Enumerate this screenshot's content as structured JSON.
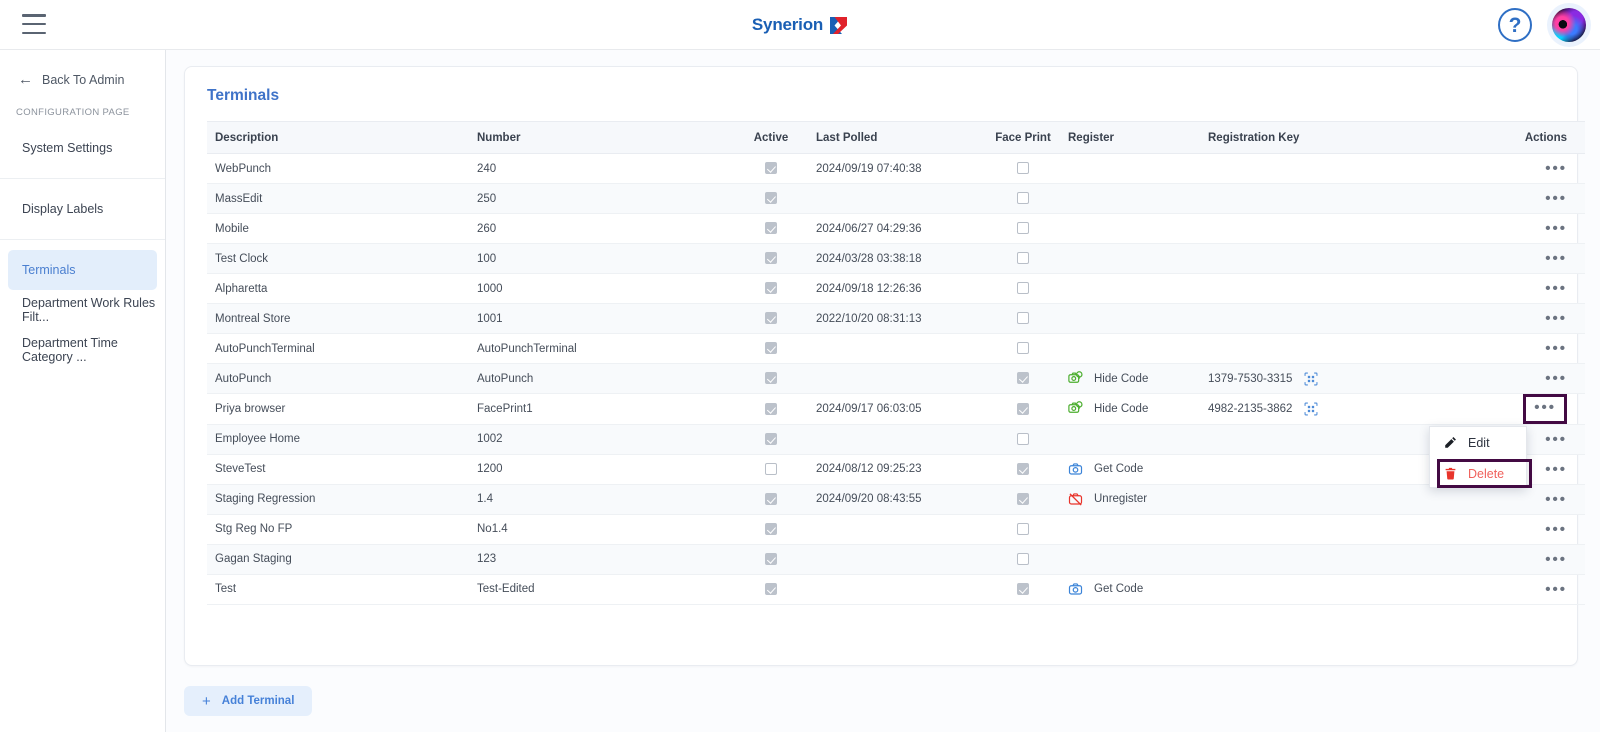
{
  "app": {
    "brand_name": "Synerion",
    "brand_color": "#1a5fb4",
    "accent_color": "#3f73c8",
    "highlight_color": "#430a43",
    "delete_color": "#f0615c"
  },
  "topbar": {
    "menu_icon": "hamburger-icon",
    "help_label": "?",
    "avatar_label": ""
  },
  "sidebar": {
    "back_label": "Back To Admin",
    "section_label": "CONFIGURATION PAGE",
    "items": [
      {
        "label": "System Settings",
        "active": false
      },
      {
        "label": "Display Labels",
        "active": false
      },
      {
        "label": "Terminals",
        "active": true
      },
      {
        "label": "Department Work Rules Filt...",
        "active": false
      },
      {
        "label": "Department Time Category ...",
        "active": false
      }
    ]
  },
  "main": {
    "title": "Terminals",
    "add_button_label": "Add Terminal",
    "add_button_plus": "+",
    "columns": [
      "Description",
      "Number",
      "Active",
      "Last Polled",
      "Face Print",
      "Register",
      "Registration Key",
      "Actions"
    ],
    "rows": [
      {
        "description": "WebPunch",
        "number": "240",
        "active": true,
        "last_polled": "2024/09/19 07:40:38",
        "face_print": false,
        "register": "",
        "register_icon": "",
        "registration_key": "",
        "actions": "•••"
      },
      {
        "description": "MassEdit",
        "number": "250",
        "active": true,
        "last_polled": "",
        "face_print": false,
        "register": "",
        "register_icon": "",
        "registration_key": "",
        "actions": "•••"
      },
      {
        "description": "Mobile",
        "number": "260",
        "active": true,
        "last_polled": "2024/06/27 04:29:36",
        "face_print": false,
        "register": "",
        "register_icon": "",
        "registration_key": "",
        "actions": "•••"
      },
      {
        "description": "Test Clock",
        "number": "100",
        "active": true,
        "last_polled": "2024/03/28 03:38:18",
        "face_print": false,
        "register": "",
        "register_icon": "",
        "registration_key": "",
        "actions": "•••"
      },
      {
        "description": "Alpharetta",
        "number": "1000",
        "active": true,
        "last_polled": "2024/09/18 12:26:36",
        "face_print": false,
        "register": "",
        "register_icon": "",
        "registration_key": "",
        "actions": "•••"
      },
      {
        "description": "Montreal Store",
        "number": "1001",
        "active": true,
        "last_polled": "2022/10/20 08:31:13",
        "face_print": false,
        "register": "",
        "register_icon": "",
        "registration_key": "",
        "actions": "•••"
      },
      {
        "description": "AutoPunchTerminal",
        "number": "AutoPunchTerminal",
        "active": true,
        "last_polled": "",
        "face_print": false,
        "register": "",
        "register_icon": "",
        "registration_key": "",
        "actions": "•••"
      },
      {
        "description": "AutoPunch",
        "number": "AutoPunch",
        "active": true,
        "last_polled": "",
        "face_print": true,
        "register": "Hide Code",
        "register_icon": "camera-green-icon",
        "registration_key": "1379-7530-3315",
        "actions": "•••"
      },
      {
        "description": "Priya browser",
        "number": "FacePrint1",
        "active": true,
        "last_polled": "2024/09/17 06:03:05",
        "face_print": true,
        "register": "Hide Code",
        "register_icon": "camera-green-icon",
        "registration_key": "4982-2135-3862",
        "actions": "•••"
      },
      {
        "description": "Employee Home",
        "number": "1002",
        "active": true,
        "last_polled": "",
        "face_print": false,
        "register": "",
        "register_icon": "",
        "registration_key": "",
        "actions": "•••"
      },
      {
        "description": "SteveTest",
        "number": "1200",
        "active": false,
        "last_polled": "2024/08/12 09:25:23",
        "face_print": true,
        "register": "Get Code",
        "register_icon": "camera-blue-icon",
        "registration_key": "",
        "actions": "•••"
      },
      {
        "description": "Staging Regression",
        "number": "1.4",
        "active": true,
        "last_polled": "2024/09/20 08:43:55",
        "face_print": true,
        "register": "Unregister",
        "register_icon": "camera-off-red-icon",
        "registration_key": "",
        "actions": "•••"
      },
      {
        "description": "Stg Reg No FP",
        "number": "No1.4",
        "active": true,
        "last_polled": "",
        "face_print": false,
        "register": "",
        "register_icon": "",
        "registration_key": "",
        "actions": "•••"
      },
      {
        "description": "Gagan Staging",
        "number": "123",
        "active": true,
        "last_polled": "",
        "face_print": false,
        "register": "",
        "register_icon": "",
        "registration_key": "",
        "actions": "•••"
      },
      {
        "description": "Test",
        "number": "Test-Edited",
        "active": true,
        "last_polled": "",
        "face_print": true,
        "register": "Get Code",
        "register_icon": "camera-blue-icon",
        "registration_key": "",
        "actions": "•••"
      }
    ]
  },
  "context_menu": {
    "open_for_row": "Priya browser",
    "items": [
      {
        "label": "Edit",
        "icon": "pencil-icon",
        "highlighted": false
      },
      {
        "label": "Delete",
        "icon": "trash-can-icon",
        "highlighted": true
      }
    ]
  }
}
